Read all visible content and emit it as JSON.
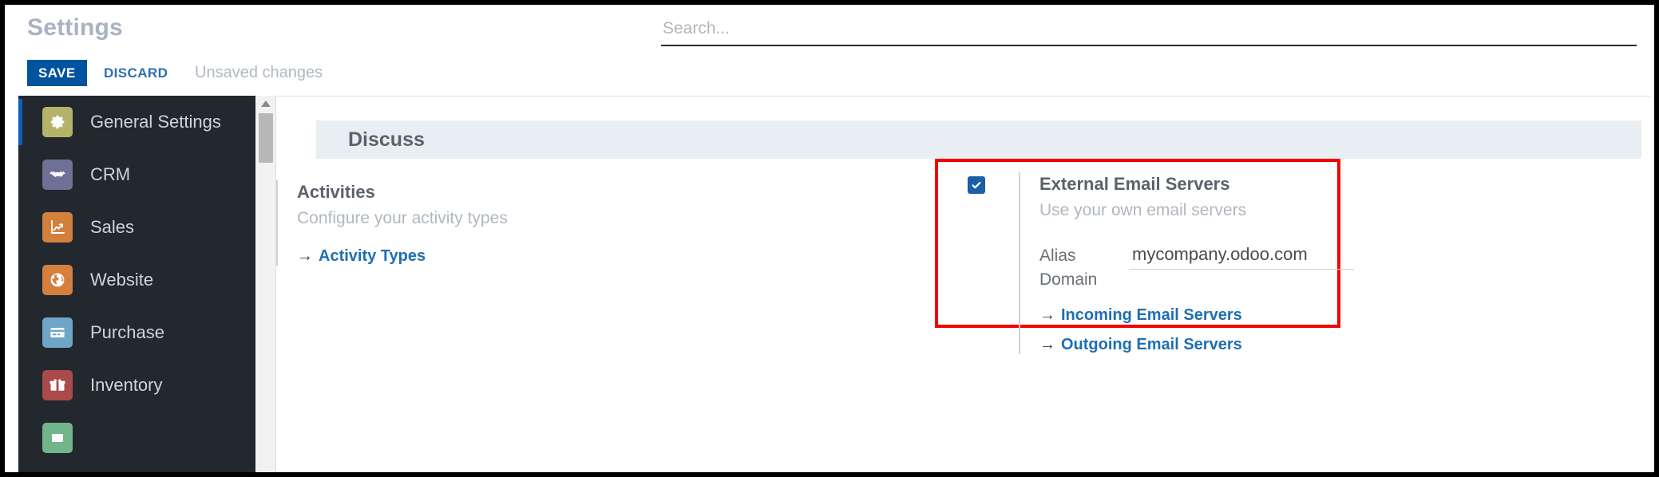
{
  "window": {
    "title": "Settings"
  },
  "search": {
    "placeholder": "Search...",
    "value": ""
  },
  "toolbar": {
    "save_label": "SAVE",
    "discard_label": "DISCARD",
    "status_label": "Unsaved changes"
  },
  "sidebar": {
    "items": [
      {
        "label": "General Settings",
        "icon": "gear-icon",
        "color": "#b5b36a",
        "active": true
      },
      {
        "label": "CRM",
        "icon": "handshake-icon",
        "color": "#6e7195",
        "active": false
      },
      {
        "label": "Sales",
        "icon": "chart-icon",
        "color": "#d3803f",
        "active": false
      },
      {
        "label": "Website",
        "icon": "globe-icon",
        "color": "#d3803f",
        "active": false
      },
      {
        "label": "Purchase",
        "icon": "card-icon",
        "color": "#6fa6c8",
        "active": false
      },
      {
        "label": "Inventory",
        "icon": "box-icon",
        "color": "#ab4a4a",
        "active": false
      },
      {
        "label": "",
        "icon": "partial-icon",
        "color": "#72b58a",
        "active": false
      }
    ]
  },
  "content": {
    "section_title": "Discuss",
    "activities": {
      "title": "Activities",
      "description": "Configure your activity types",
      "link_label": "Activity Types",
      "link_arrow": "→"
    },
    "external_email": {
      "checkbox_checked": true,
      "title": "External Email Servers",
      "description": "Use your own email servers",
      "alias_label": "Alias Domain",
      "alias_value": "mycompany.odoo.com",
      "incoming_link_label": "Incoming Email Servers",
      "outgoing_link_label": "Outgoing Email Servers",
      "link_arrow": "→",
      "highlight_color": "#f50000"
    }
  }
}
